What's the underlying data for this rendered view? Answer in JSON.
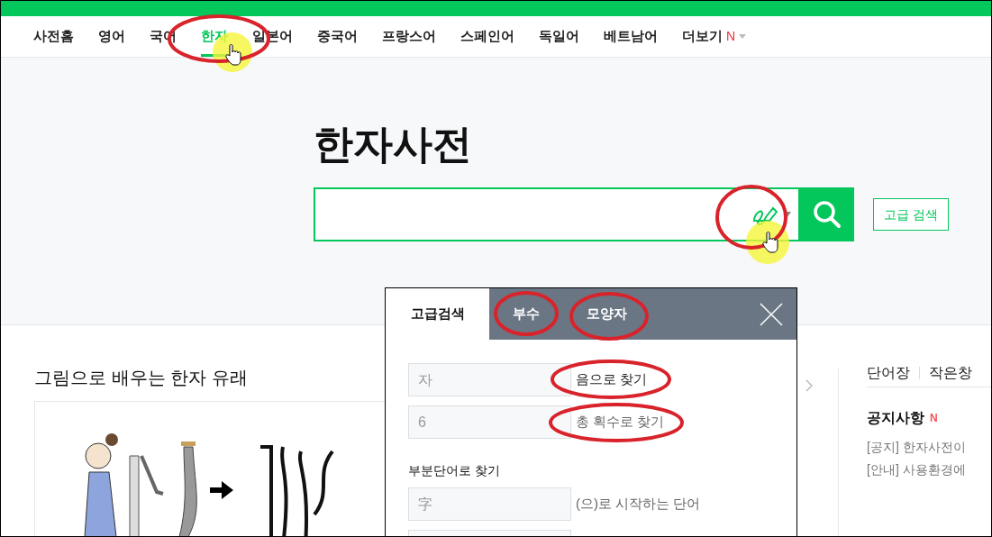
{
  "nav": {
    "items": [
      {
        "label": "사전홈",
        "selected": false
      },
      {
        "label": "영어",
        "selected": false
      },
      {
        "label": "국어",
        "selected": false
      },
      {
        "label": "한자",
        "selected": true
      },
      {
        "label": "일본어",
        "selected": false
      },
      {
        "label": "중국어",
        "selected": false
      },
      {
        "label": "프랑스어",
        "selected": false
      },
      {
        "label": "스페인어",
        "selected": false
      },
      {
        "label": "독일어",
        "selected": false
      },
      {
        "label": "베트남어",
        "selected": false
      },
      {
        "label": "더보기",
        "selected": false,
        "badge": "N",
        "dropdown": true
      }
    ]
  },
  "title": "한자사전",
  "advanced_button": "고급 검색",
  "section": {
    "title": "그림으로 배우는 한자 유래"
  },
  "popup": {
    "tabs": [
      {
        "label": "고급검색",
        "selected": true
      },
      {
        "label": "부수",
        "selected": false
      },
      {
        "label": "모양자",
        "selected": false
      }
    ],
    "fields": [
      {
        "placeholder": "자",
        "label": "음으로 찾기"
      },
      {
        "placeholder": "6",
        "label": "총 획수로 찾기"
      }
    ],
    "partial_heading": "부분단어로 찾기",
    "partial_fields": [
      {
        "kind": "labeled",
        "placeholder": "字",
        "label": "(으)로 시작하는 단어"
      },
      {
        "kind": "blank"
      }
    ]
  },
  "side": {
    "links": [
      "단어장",
      "작은창"
    ],
    "notice_title": "공지사항",
    "notice_badge": "N",
    "notices": [
      "[공지] 한자사전이",
      "[안내] 사용환경에"
    ]
  }
}
